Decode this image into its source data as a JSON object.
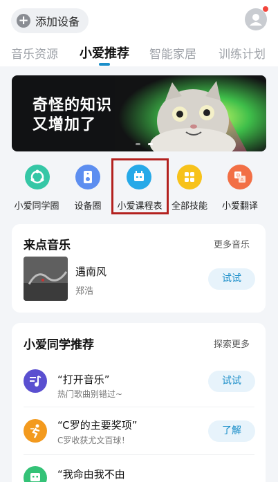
{
  "header": {
    "add_device": "添加设备",
    "tabs": [
      "音乐资源",
      "小爱推荐",
      "智能家居",
      "训练计划"
    ]
  },
  "banner": {
    "line1": "奇怪的知识",
    "line2": "又增加了"
  },
  "quick_actions": [
    {
      "label": "小爱同学圈",
      "icon": "loop-icon",
      "color": "#35c7a6"
    },
    {
      "label": "设备圈",
      "icon": "speaker-icon",
      "color": "#5d8ef0"
    },
    {
      "label": "小爱课程表",
      "icon": "calendar-icon",
      "color": "#26a9e8"
    },
    {
      "label": "全部技能",
      "icon": "grid-icon",
      "color": "#f7c21b"
    },
    {
      "label": "小爱翻译",
      "icon": "translate-icon",
      "color": "#f26f45"
    }
  ],
  "music": {
    "title": "来点音乐",
    "more": "更多音乐",
    "song": "遇南风",
    "artist": "郑浩",
    "try": "试试"
  },
  "recommend": {
    "title": "小爱同学推荐",
    "more": "探索更多",
    "items": [
      {
        "title": "“打开音乐”",
        "subtitle": "热门歌曲别错过~",
        "button": "试试",
        "icon": "music-note-icon",
        "color": "#5a4fd0"
      },
      {
        "title": "“C罗的主要奖项”",
        "subtitle": "C罗收获尤文百球！",
        "button": "了解",
        "icon": "runner-icon",
        "color": "#f39a1e"
      },
      {
        "title": "“我命由我不由",
        "subtitle": "",
        "button": "",
        "icon": "robot-icon",
        "color": "#34c277"
      }
    ]
  },
  "colors": {
    "accent": "#1a8ec9",
    "highlight_box": "#b3211f"
  }
}
